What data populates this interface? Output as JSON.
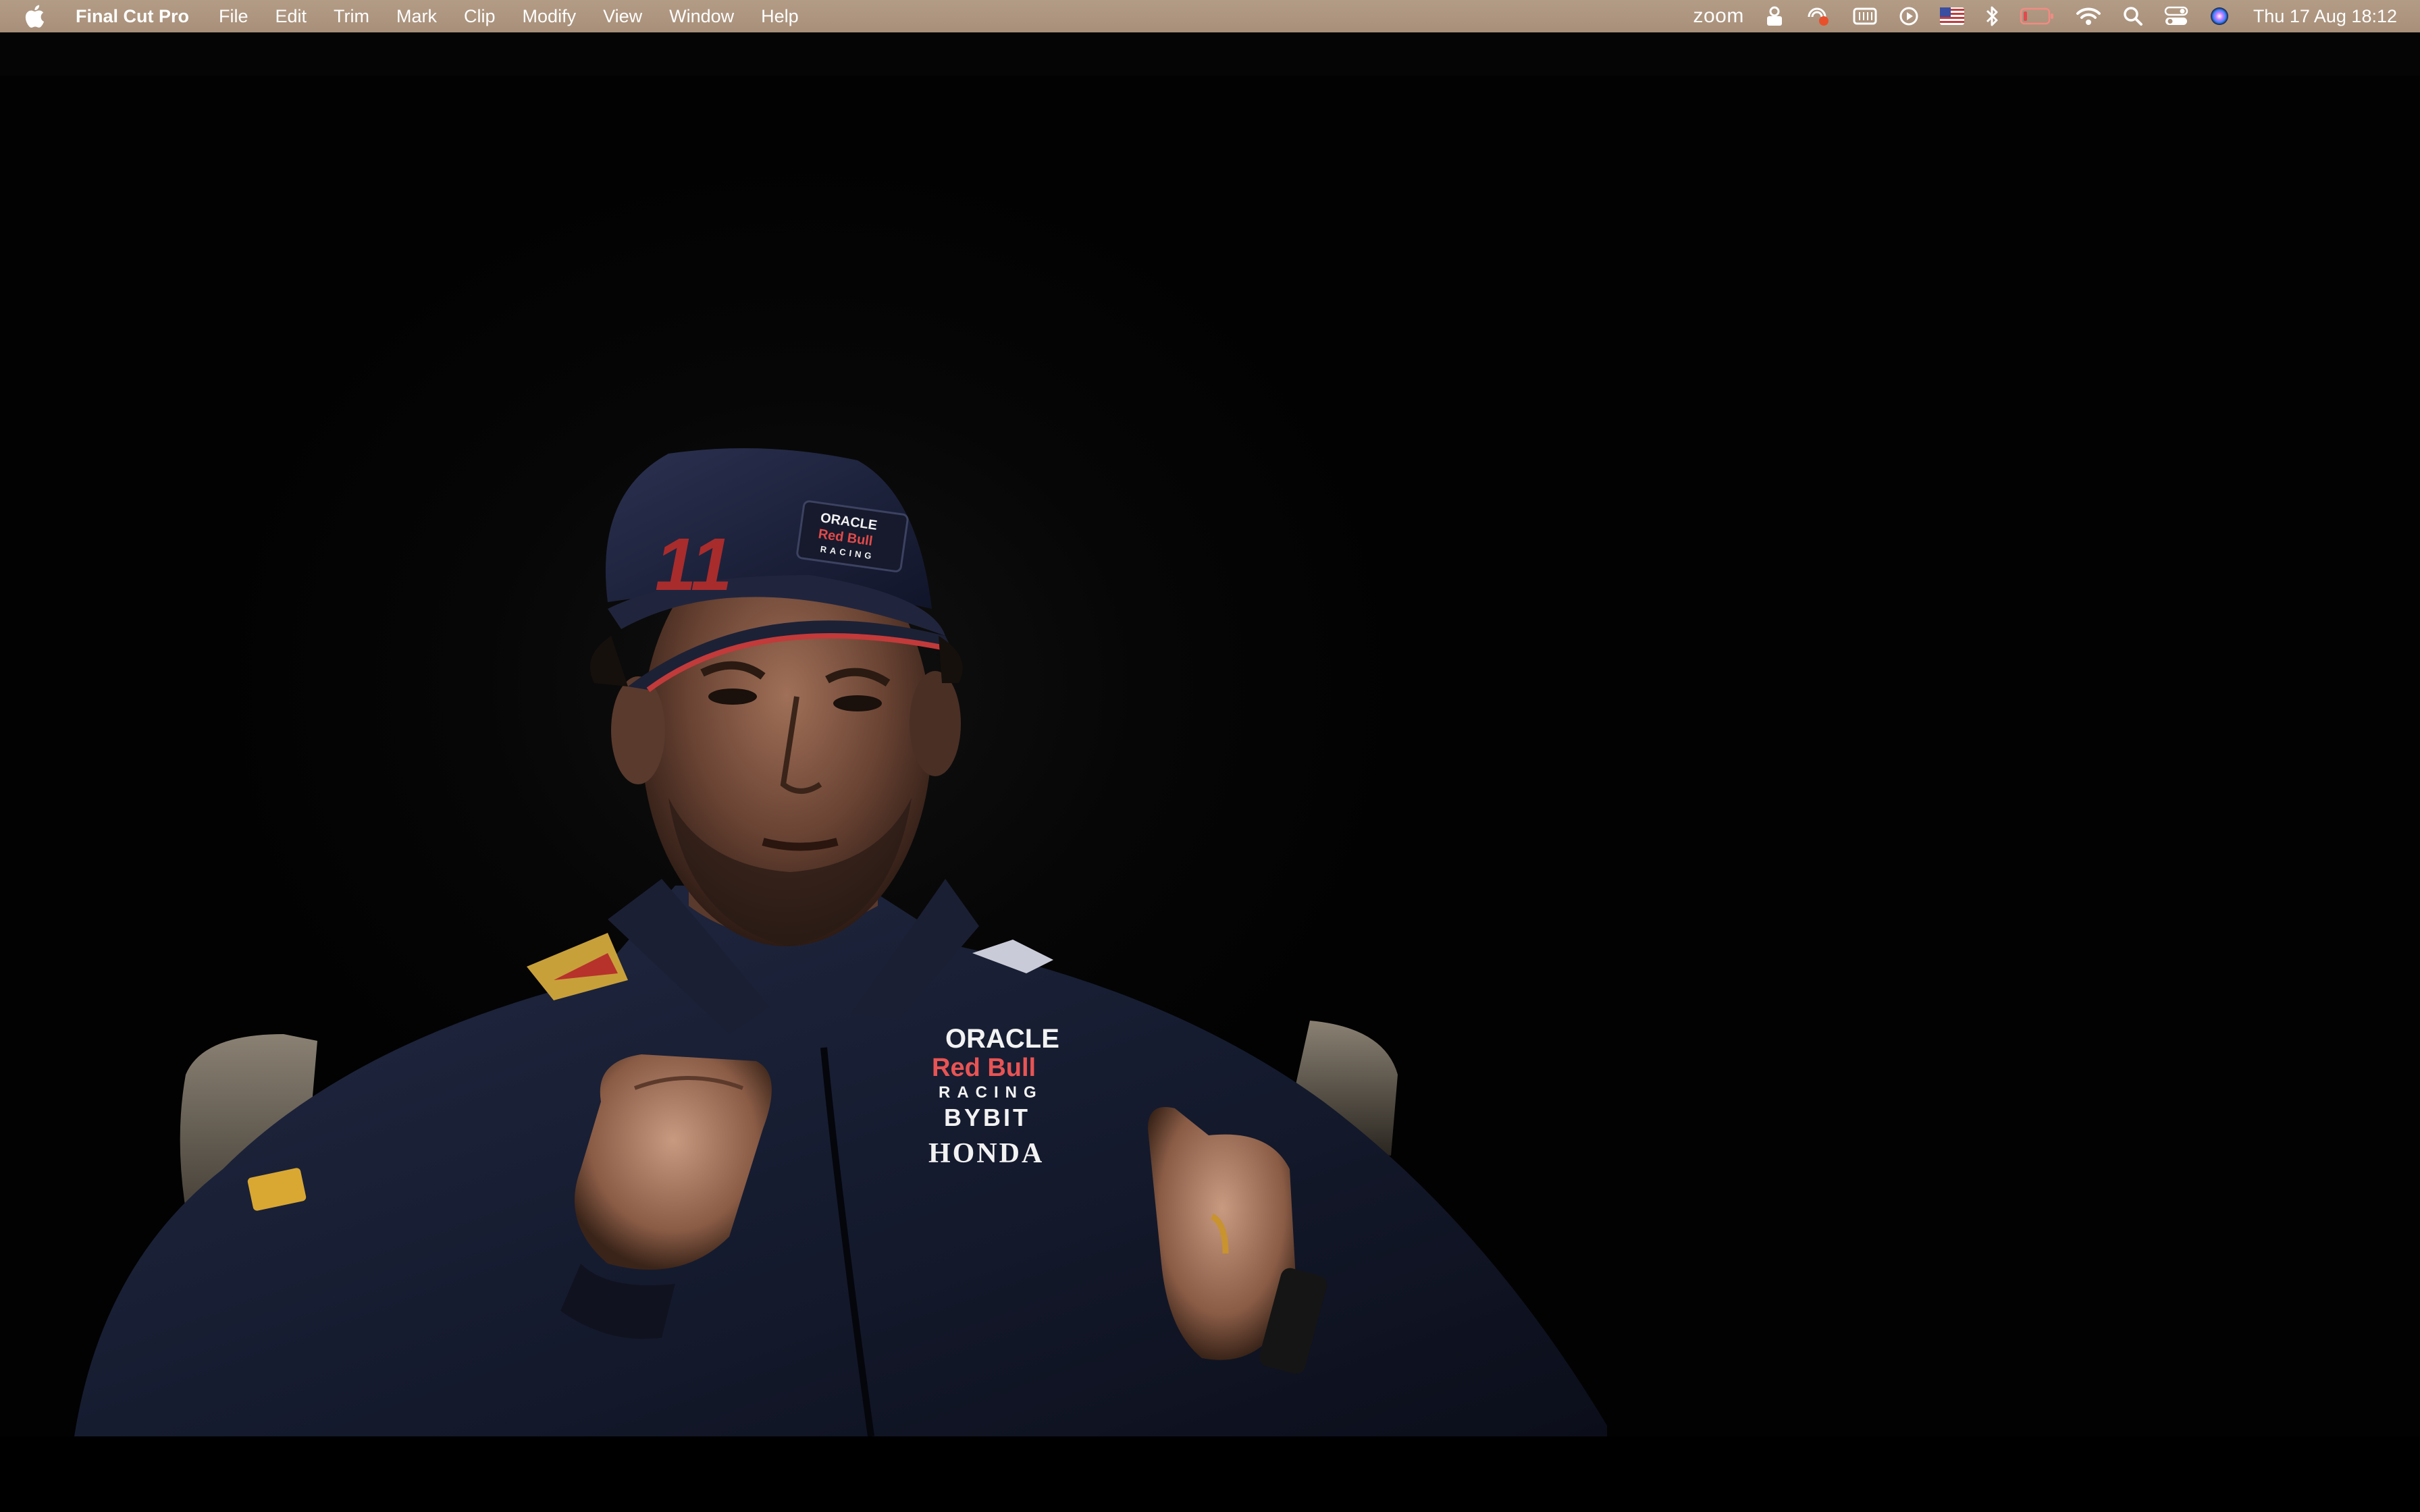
{
  "menubar": {
    "app_name": "Final Cut Pro",
    "menus": [
      "File",
      "Edit",
      "Trim",
      "Mark",
      "Clip",
      "Modify",
      "View",
      "Window",
      "Help"
    ],
    "status_zoom": "zoom",
    "clock": "Thu 17 Aug  18:12"
  },
  "video": {
    "cap_number": "11",
    "cap_sponsor_line1": "ORACLE",
    "cap_sponsor_line2": "Red Bull",
    "cap_sponsor_line3": "RACING",
    "jacket_sponsor_line1": "ORACLE",
    "jacket_sponsor_line2": "Red Bull",
    "jacket_sponsor_line3": "RACING",
    "jacket_bybit": "BYBIT",
    "jacket_honda": "HONDA"
  }
}
